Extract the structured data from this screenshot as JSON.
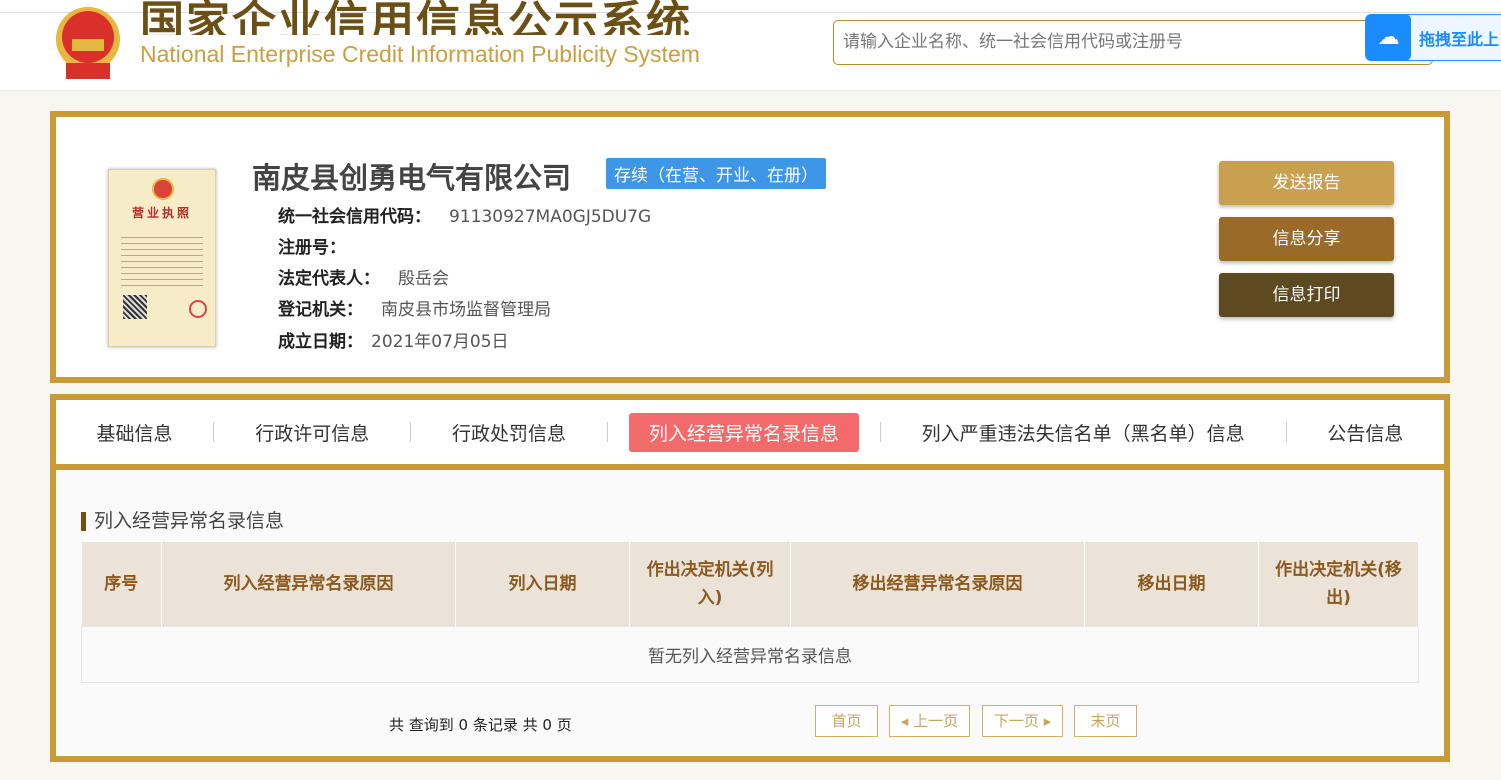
{
  "header": {
    "title_cn": "国家企业信用信息公示系统",
    "title_en": "National Enterprise Credit Information Publicity System",
    "search_placeholder": "请输入企业名称、统一社会信用代码或注册号",
    "baidu_label": "拖拽至此上"
  },
  "company": {
    "name": "南皮县创勇电气有限公司",
    "status": "存续（在营、开业、在册）",
    "license_label": "营业执照",
    "fields": [
      {
        "label": "统一社会信用代码：",
        "value": "91130927MA0GJ5DU7G"
      },
      {
        "label": "注册号：",
        "value": ""
      },
      {
        "label": "法定代表人：",
        "value": "殷岳会"
      },
      {
        "label": "登记机关：",
        "value": "南皮县市场监督管理局"
      },
      {
        "label": "成立日期：",
        "value": "2021年07月05日"
      }
    ]
  },
  "actions": {
    "send": "发送报告",
    "share": "信息分享",
    "print": "信息打印",
    "colors": [
      "#c99f50",
      "#9a6a28",
      "#5e4a20"
    ]
  },
  "tabs": [
    "基础信息",
    "行政许可信息",
    "行政处罚信息",
    "列入经营异常名录信息",
    "列入严重违法失信名单（黑名单）信息",
    "公告信息"
  ],
  "section": {
    "title": "列入经营异常名录信息",
    "columns": [
      "序号",
      "列入经营异常名录原因",
      "列入日期",
      "作出决定机关(列入)",
      "移出经营异常名录原因",
      "移出日期",
      "作出决定机关(移出)"
    ],
    "empty": "暂无列入经营异常名录信息"
  },
  "pagination": {
    "summary": "共 查询到 0 条记录 共 0 页",
    "first": "首页",
    "prev": "上一页",
    "next": "下一页",
    "last": "末页"
  }
}
